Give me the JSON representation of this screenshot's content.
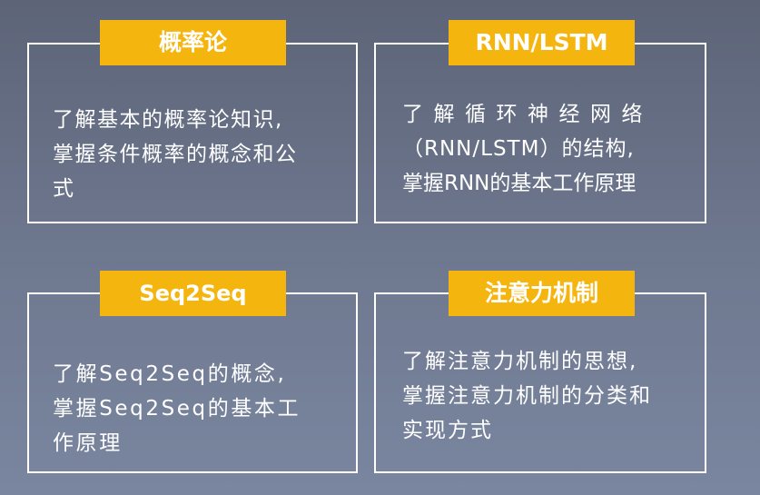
{
  "colors": {
    "tag_background": "#f5b50f",
    "border": "#ffffff",
    "text": "#ffffff",
    "background_top": "#5d6478",
    "background_bottom": "#7a86a0"
  },
  "cards": [
    {
      "title": "概率论",
      "lines": [
        "了解基本的概率论知识,",
        "掌握条件概率的概念和公",
        "式"
      ]
    },
    {
      "title": "RNN/LSTM",
      "lines": [
        "了解循环神经网络",
        "（RNN/LSTM）的结构,",
        "掌握RNN的基本工作原理"
      ]
    },
    {
      "title": "Seq2Seq",
      "lines": [
        "了解Seq2Seq的概念,",
        "掌握Seq2Seq的基本工",
        "作原理"
      ]
    },
    {
      "title": "注意力机制",
      "lines": [
        "了解注意力机制的思想,",
        "掌握注意力机制的分类和",
        "实现方式"
      ]
    }
  ]
}
